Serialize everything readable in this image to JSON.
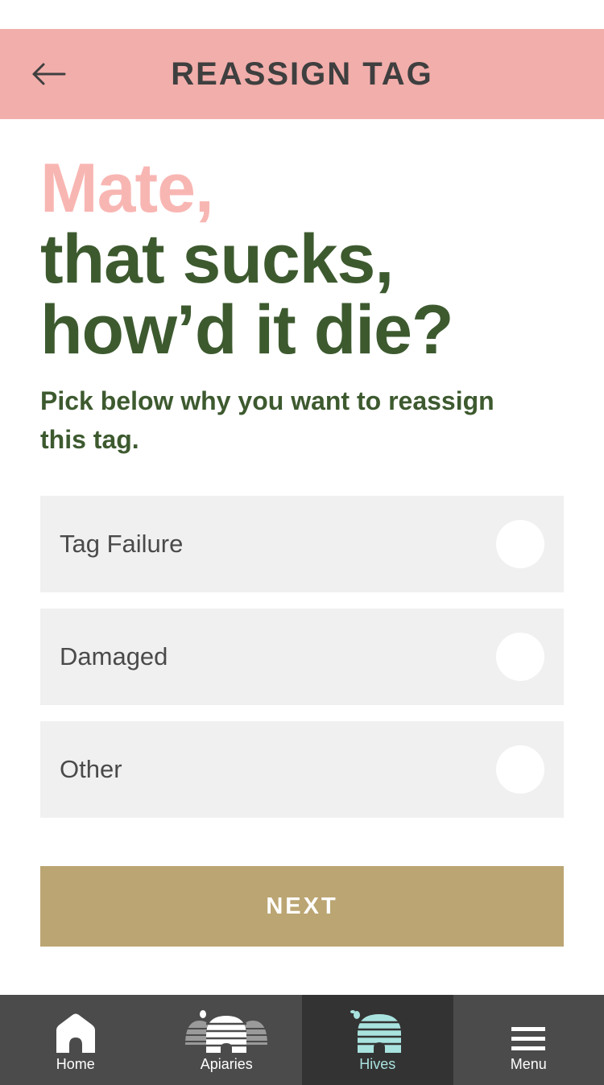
{
  "header": {
    "title": "REASSIGN TAG",
    "back_icon": "arrow-left-icon"
  },
  "headline": {
    "line1": "Mate,",
    "line2": "that sucks,",
    "line3": "how’d it die?"
  },
  "subtitle": "Pick below why you want to reassign this tag.",
  "options": [
    {
      "label": "Tag Failure",
      "selected": false
    },
    {
      "label": "Damaged",
      "selected": false
    },
    {
      "label": "Other",
      "selected": false
    }
  ],
  "next_label": "NEXT",
  "tabs": [
    {
      "label": "Home",
      "icon": "home-icon",
      "active": false
    },
    {
      "label": "Apiaries",
      "icon": "apiaries-icon",
      "active": false
    },
    {
      "label": "Hives",
      "icon": "hive-icon",
      "active": true
    },
    {
      "label": "Menu",
      "icon": "menu-icon",
      "active": false
    }
  ],
  "colors": {
    "header_bg": "#f2aeab",
    "accent_pink": "#f8b6b3",
    "accent_green": "#3d5a2f",
    "button_gold": "#bba572",
    "tabbar_bg": "#4b4b4b",
    "tab_active_bg": "#333333",
    "tab_active_text": "#a9e3df"
  }
}
